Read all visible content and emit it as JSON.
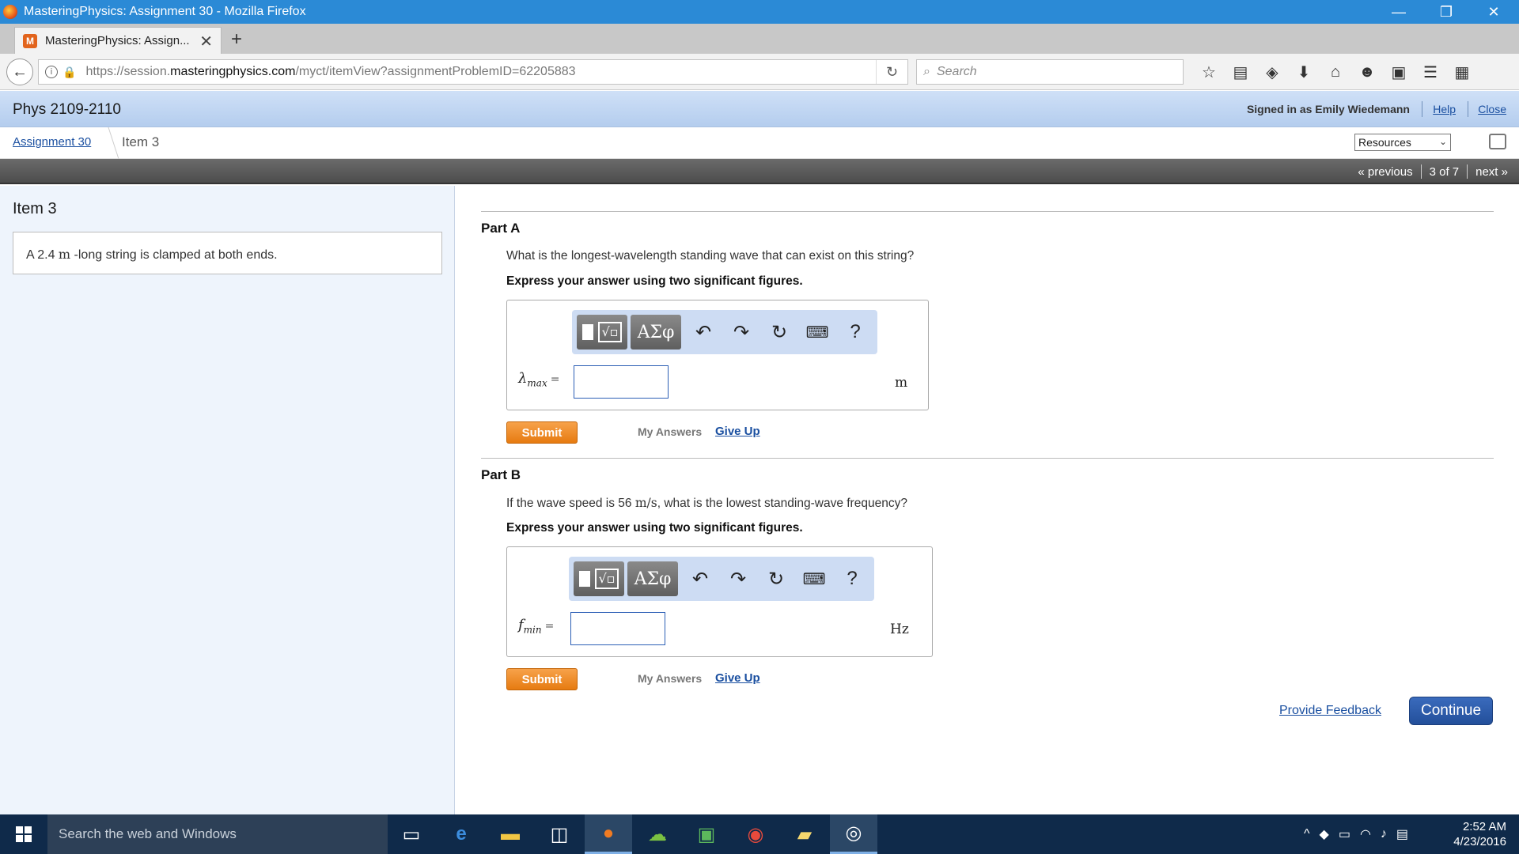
{
  "window": {
    "title": "MasteringPhysics: Assignment 30 - Mozilla Firefox",
    "minimize": "—",
    "restore": "❐",
    "close": "✕"
  },
  "tab": {
    "title": "MasteringPhysics: Assign...",
    "close": "✕",
    "new_tab": "+"
  },
  "navbar": {
    "url_prefix": "https://session.",
    "url_domain": "masteringphysics.com",
    "url_path": "/myct/itemView?assignmentProblemID=62205883",
    "search_placeholder": "Search"
  },
  "header": {
    "course": "Phys 2109-2110",
    "signed_in": "Signed in as Emily Wiedemann",
    "help": "Help",
    "close": "Close"
  },
  "breadcrumb": {
    "assignment": "Assignment 30",
    "item": "Item 3",
    "resources": "Resources"
  },
  "pager": {
    "previous": "« previous",
    "position": "3 of 7",
    "next": "next »"
  },
  "left": {
    "heading": "Item 3",
    "problem_pre": "A 2.4 ",
    "problem_unit": "m",
    "problem_post": " -long string is clamped at both ends."
  },
  "toolbar": {
    "greek": "ΑΣφ",
    "help": "?"
  },
  "partA": {
    "label": "Part A",
    "question": "What is the longest-wavelength standing wave that can exist on this string?",
    "instruction": "Express your answer using two significant figures.",
    "var": "λ",
    "var_sub": "max",
    "eq": "=",
    "unit": "m",
    "submit": "Submit",
    "my_answers": "My Answers",
    "give_up": "Give Up"
  },
  "partB": {
    "label": "Part B",
    "question_pre": "If the wave speed is 56 ",
    "question_unit": "m/s",
    "question_post": ", what is the lowest standing-wave frequency?",
    "instruction": "Express your answer using two significant figures.",
    "var": "f",
    "var_sub": "min",
    "eq": "=",
    "unit": "Hz",
    "submit": "Submit",
    "my_answers": "My Answers",
    "give_up": "Give Up"
  },
  "footer": {
    "feedback": "Provide Feedback",
    "continue": "Continue"
  },
  "taskbar": {
    "search": "Search the web and Windows",
    "time": "2:52 AM",
    "date": "4/23/2016"
  }
}
